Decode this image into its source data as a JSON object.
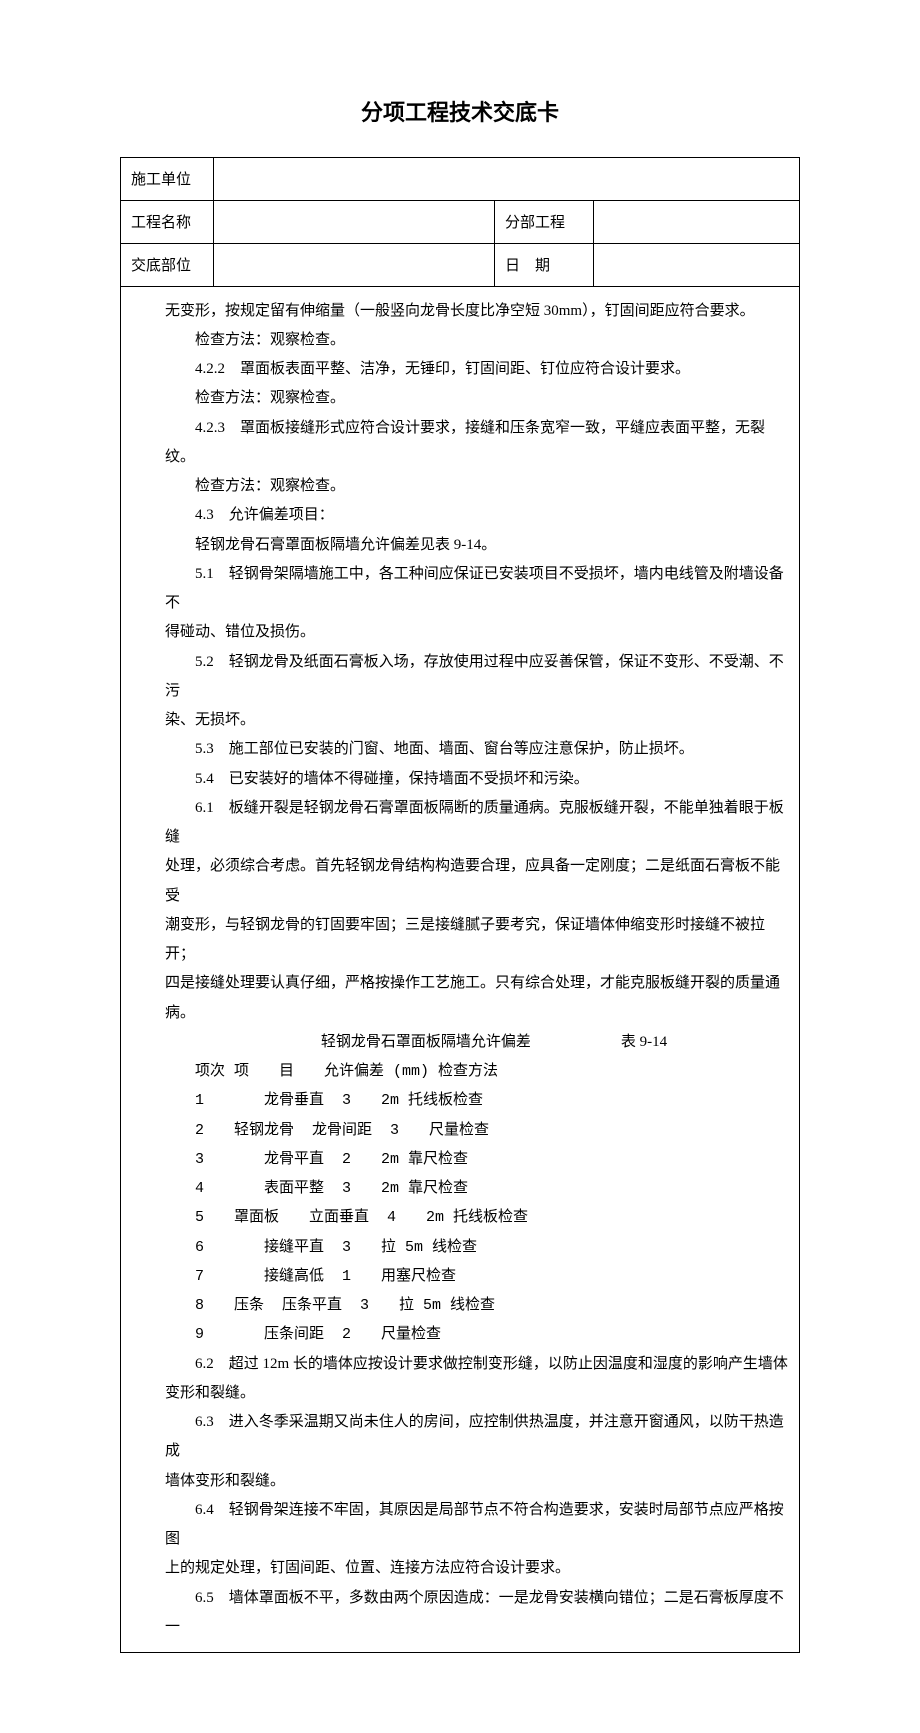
{
  "title": "分项工程技术交底卡",
  "header": {
    "unitLabel": "施工单位",
    "projectLabel": "工程名称",
    "subLabel": "分部工程",
    "partLabel": "交底部位",
    "dateLabel": "日 期"
  },
  "body": {
    "p0": "无变形，按规定留有伸缩量（一般竖向龙骨长度比净空短 30mm），钉固间距应符合要求。",
    "m0": "检查方法：观察检查。",
    "p1": "4.2.2 罩面板表面平整、洁净，无锤印，钉固间距、钉位应符合设计要求。",
    "m1": "检查方法：观察检查。",
    "p2": "4.2.3 罩面板接缝形式应符合设计要求，接缝和压条宽窄一致，平缝应表面平整，无裂纹。",
    "m2": "检查方法：观察检查。",
    "p43": "4.3 允许偏差项目：",
    "p43a": "轻钢龙骨石膏罩面板隔墙允许偏差见表 9-14。",
    "p51": "5.1 轻钢骨架隔墙施工中，各工种间应保证已安装项目不受损坏，墙内电线管及附墙设备不",
    "p51b": "得碰动、错位及损伤。",
    "p52": "5.2 轻钢龙骨及纸面石膏板入场，存放使用过程中应妥善保管，保证不变形、不受潮、不污",
    "p52b": "染、无损坏。",
    "p53": "5.3 施工部位已安装的门窗、地面、墙面、窗台等应注意保护，防止损坏。",
    "p54": "5.4 已安装好的墙体不得碰撞，保持墙面不受损坏和污染。",
    "p61": "6.1 板缝开裂是轻钢龙骨石膏罩面板隔断的质量通病。克服板缝开裂，不能单独着眼于板缝",
    "p61b": "处理，必须综合考虑。首先轻钢龙骨结构构造要合理，应具备一定刚度；二是纸面石膏板不能受",
    "p61c": "潮变形，与轻钢龙骨的钉固要牢固；三是接缝腻子要考究，保证墙体伸缩变形时接缝不被拉开；",
    "p61d": "四是接缝处理要认真仔细，严格按操作工艺施工。只有综合处理，才能克服板缝开裂的质量通病。",
    "tolTitle": "轻钢龙骨石罩面板隔墙允许偏差      表 9-14",
    "tolHead": "项次 项  目  允许偏差 (mm) 检查方法",
    "t1": "1    龙骨垂直  3  2m 托线板检查",
    "t2": "2  轻钢龙骨  龙骨间距  3  尺量检查",
    "t3": "3    龙骨平直  2  2m 靠尺检查",
    "t4": "4    表面平整  3  2m 靠尺检查",
    "t5": "5  罩面板  立面垂直  4  2m 托线板检查",
    "t6": "6    接缝平直  3  拉 5m 线检查",
    "t7": "7    接缝高低  1  用塞尺检查",
    "t8": "8  压条  压条平直  3  拉 5m 线检查",
    "t9": "9    压条间距  2  尺量检查",
    "p62": "6.2 超过 12m 长的墙体应按设计要求做控制变形缝，以防止因温度和湿度的影响产生墙体",
    "p62b": "变形和裂缝。",
    "p63": "6.3 进入冬季采温期又尚未住人的房间，应控制供热温度，并注意开窗通风，以防干热造成",
    "p63b": "墙体变形和裂缝。",
    "p64": "6.4 轻钢骨架连接不牢固，其原因是局部节点不符合构造要求，安装时局部节点应严格按图",
    "p64b": "上的规定处理，钉固间距、位置、连接方法应符合设计要求。",
    "p65": "6.5 墙体罩面板不平，多数由两个原因造成：一是龙骨安装横向错位；二是石膏板厚度不一"
  }
}
